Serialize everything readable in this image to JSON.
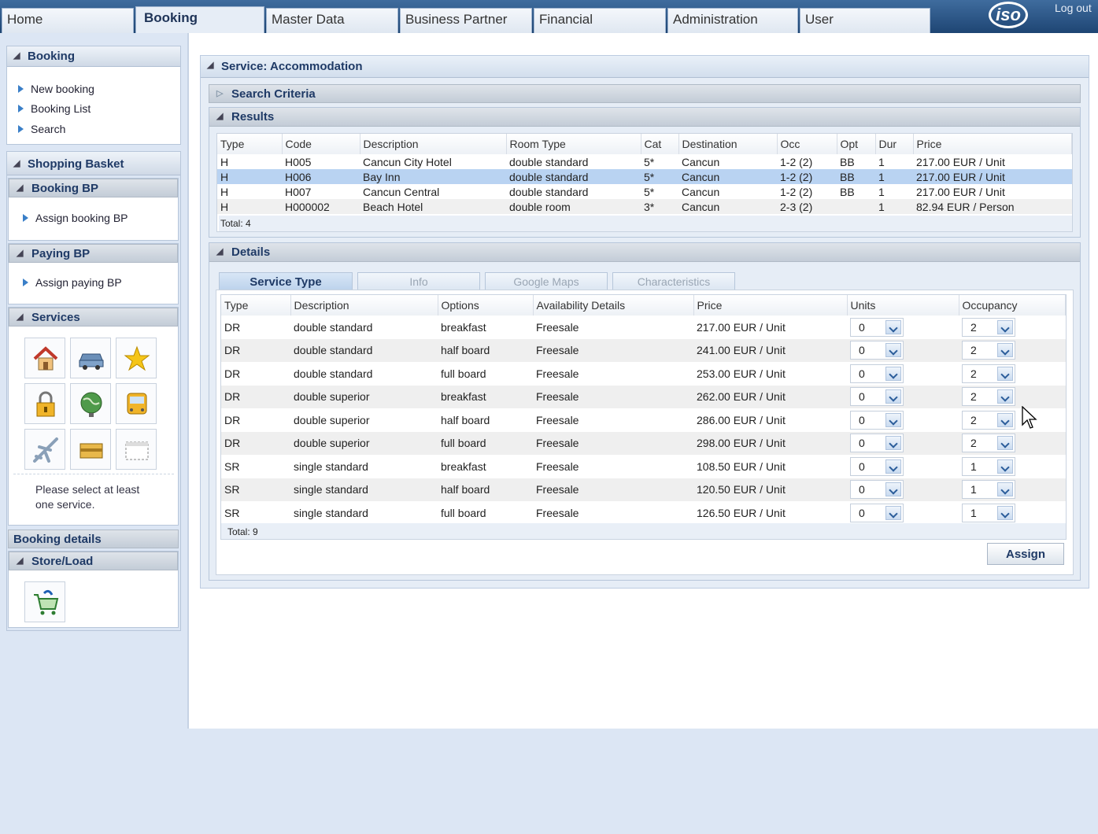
{
  "topnav": {
    "tabs": [
      "Home",
      "Booking",
      "Master Data",
      "Business Partner",
      "Financial",
      "Administration",
      "User"
    ],
    "logo": "iso",
    "logout": "Log out"
  },
  "sidebar": {
    "booking": {
      "title": "Booking",
      "links": [
        "New booking",
        "Booking List",
        "Search"
      ]
    },
    "basket": {
      "title": "Shopping Basket"
    },
    "booking_bp": {
      "title": "Booking BP",
      "link": "Assign booking BP"
    },
    "paying_bp": {
      "title": "Paying BP",
      "link": "Assign paying BP"
    },
    "services": {
      "title": "Services",
      "icons": [
        "house-icon",
        "car-icon",
        "star-icon",
        "lock-icon",
        "globe-icon",
        "bus-icon",
        "plane-icon",
        "wallet-icon",
        "calendar-icon"
      ],
      "note_line1": "Please select at least",
      "note_line2": "one service."
    },
    "booking_details": {
      "title": "Booking details"
    },
    "store_load": {
      "title": "Store/Load",
      "icon": "cart-icon"
    }
  },
  "main": {
    "title": "Service: Accommodation",
    "search_criteria": "Search Criteria",
    "results": {
      "title": "Results",
      "headers": [
        "Type",
        "Code",
        "Description",
        "Room Type",
        "Cat",
        "Destination",
        "Occ",
        "Opt",
        "Dur",
        "Price"
      ],
      "rows": [
        [
          "H",
          "H005",
          "Cancun City Hotel",
          "double standard",
          "5*",
          "Cancun",
          "1-2 (2)",
          "BB",
          "1",
          "217.00 EUR / Unit"
        ],
        [
          "H",
          "H006",
          "Bay Inn",
          "double standard",
          "5*",
          "Cancun",
          "1-2 (2)",
          "BB",
          "1",
          "217.00 EUR / Unit"
        ],
        [
          "H",
          "H007",
          "Cancun Central",
          "double standard",
          "5*",
          "Cancun",
          "1-2 (2)",
          "BB",
          "1",
          "217.00 EUR / Unit"
        ],
        [
          "H",
          "H000002",
          "Beach Hotel",
          "double room",
          "3*",
          "Cancun",
          "2-3 (2)",
          "",
          "1",
          "82.94 EUR / Person"
        ]
      ],
      "selected_row": 1,
      "total": "Total: 4"
    },
    "details": {
      "title": "Details",
      "tabs": [
        "Service Type",
        "Info",
        "Google Maps",
        "Characteristics"
      ],
      "headers": [
        "Type",
        "Description",
        "Options",
        "Availability Details",
        "Price",
        "Units",
        "Occupancy"
      ],
      "rows": [
        [
          "DR",
          "double standard",
          "breakfast",
          "Freesale",
          "217.00 EUR / Unit",
          "0",
          "2"
        ],
        [
          "DR",
          "double standard",
          "half board",
          "Freesale",
          "241.00 EUR / Unit",
          "0",
          "2"
        ],
        [
          "DR",
          "double standard",
          "full board",
          "Freesale",
          "253.00 EUR / Unit",
          "0",
          "2"
        ],
        [
          "DR",
          "double superior",
          "breakfast",
          "Freesale",
          "262.00 EUR / Unit",
          "0",
          "2"
        ],
        [
          "DR",
          "double superior",
          "half board",
          "Freesale",
          "286.00 EUR / Unit",
          "0",
          "2"
        ],
        [
          "DR",
          "double superior",
          "full board",
          "Freesale",
          "298.00 EUR / Unit",
          "0",
          "2"
        ],
        [
          "SR",
          "single standard",
          "breakfast",
          "Freesale",
          "108.50 EUR / Unit",
          "0",
          "1"
        ],
        [
          "SR",
          "single standard",
          "half board",
          "Freesale",
          "120.50 EUR / Unit",
          "0",
          "1"
        ],
        [
          "SR",
          "single standard",
          "full board",
          "Freesale",
          "126.50 EUR / Unit",
          "0",
          "1"
        ]
      ],
      "total": "Total: 9",
      "assign": "Assign"
    }
  },
  "colors": {
    "selected_row": "#b9d3f2",
    "accent": "#1f3a66"
  }
}
